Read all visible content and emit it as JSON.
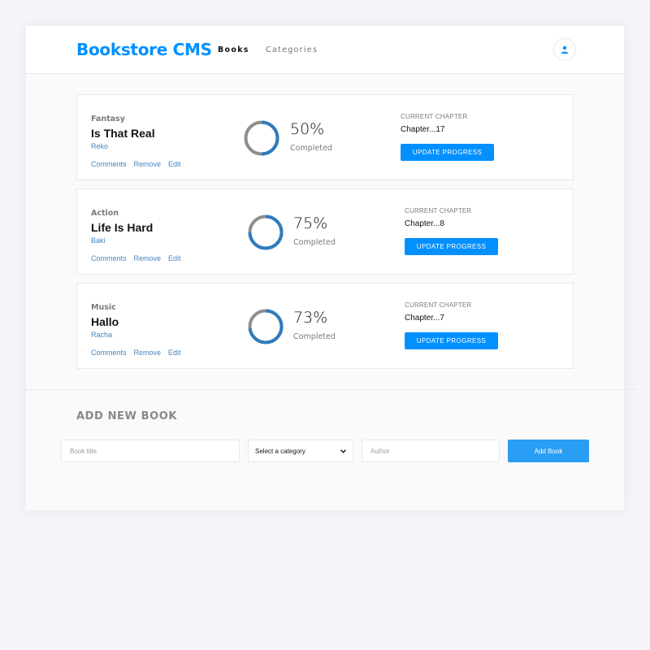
{
  "header": {
    "logo": "Bookstore CMS",
    "nav": [
      "Books",
      "Categories"
    ],
    "user_icon": "user-icon"
  },
  "books": [
    {
      "genre": "Fantasy",
      "title": "Is That Real",
      "author": "Reko",
      "progress_percent": 50,
      "percent_label": "50%",
      "completed_label": "Completed",
      "chapter_label": "CURRENT CHAPTER",
      "chapter": "Chapter...17",
      "update_label": "UPDATE PROGRESS"
    },
    {
      "genre": "Action",
      "title": "Life Is Hard",
      "author": "Baki",
      "progress_percent": 75,
      "percent_label": "75%",
      "completed_label": "Completed",
      "chapter_label": "CURRENT CHAPTER",
      "chapter": "Chapter...8",
      "update_label": "UPDATE PROGRESS"
    },
    {
      "genre": "Music",
      "title": "Hallo",
      "author": "Racha",
      "progress_percent": 73,
      "percent_label": "73%",
      "completed_label": "Completed",
      "chapter_label": "CURRENT CHAPTER",
      "chapter": "Chapter...7",
      "update_label": "UPDATE PROGRESS"
    }
  ],
  "actions": [
    "Comments",
    "Remove",
    "Edit"
  ],
  "add_form": {
    "heading": "ADD NEW BOOK",
    "title_placeholder": "Book title",
    "category_selected": "Select a category",
    "author_placeholder": "Author",
    "submit_label": "Add Book"
  },
  "colors": {
    "accent": "#0290ff",
    "ring_fill": "#307bbe",
    "ring_track": "#8e8e8e",
    "link": "#4386bf"
  }
}
